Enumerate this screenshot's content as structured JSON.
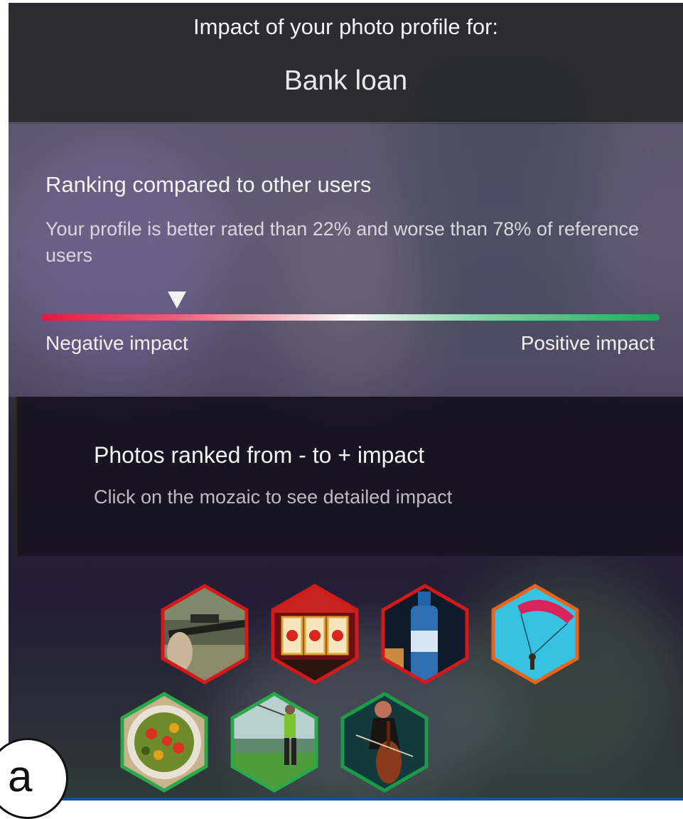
{
  "header": {
    "caption": "Impact of your photo profile for:",
    "title": "Bank loan"
  },
  "ranking": {
    "title": "Ranking compared to other users",
    "description": "Your profile is better rated than 22% and worse than 78% of reference users",
    "better_than_percent": 22,
    "worse_than_percent": 78,
    "negative_label": "Negative impact",
    "positive_label": "Positive impact",
    "bar_colors": {
      "negative": "#e5173f",
      "neutral": "#f8f8f8",
      "positive": "#1faa5a"
    }
  },
  "photos": {
    "title": "Photos ranked from - to + impact",
    "hint": "Click on the mozaic to see detailed impact",
    "tiles": [
      {
        "subject": "rifle",
        "border": "#d21a1a"
      },
      {
        "subject": "slot-machine",
        "border": "#d21a1a"
      },
      {
        "subject": "water-bottle",
        "border": "#d21a1a"
      },
      {
        "subject": "parachute",
        "border": "#e8641b"
      },
      {
        "subject": "salad",
        "border": "#2aa84a"
      },
      {
        "subject": "golf",
        "border": "#2aa84a"
      },
      {
        "subject": "cello",
        "border": "#1c9a48"
      }
    ]
  },
  "badge": {
    "label": "a"
  }
}
